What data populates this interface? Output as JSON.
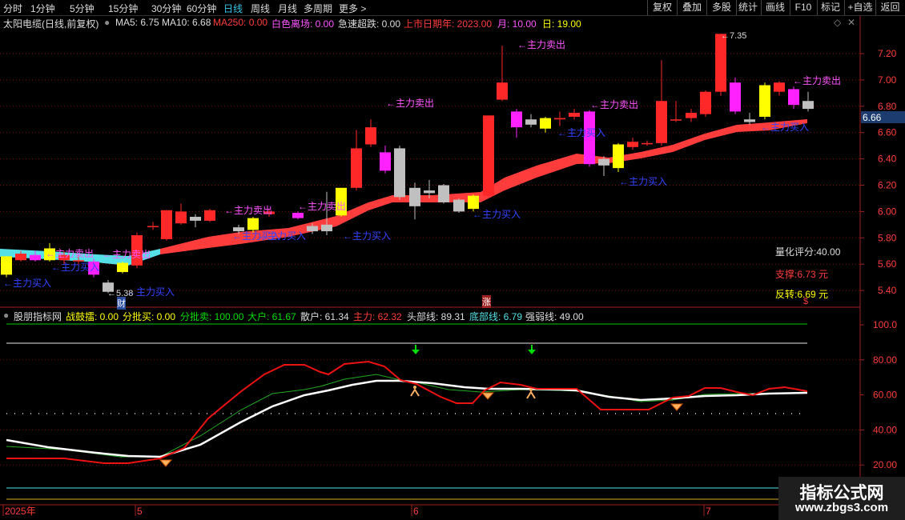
{
  "toolbar": {
    "periods": [
      "分时",
      "1分钟",
      "5分钟",
      "15分钟",
      "30分钟",
      "60分钟",
      "日线",
      "周线",
      "月线",
      "多周期",
      "更多 >"
    ],
    "active_period": "日线",
    "buttons": [
      "复权",
      "叠加",
      "多股",
      "统计",
      "画线",
      "F10",
      "标记",
      "+自选",
      "返回"
    ]
  },
  "header": {
    "stock": "太阳电缆(日线,前复权)",
    "ma5": "MA5: 6.75",
    "ma10": "MA10: 6.68",
    "ma250": "MA250: 0.00",
    "white_exit": "白色离场: 0.00",
    "rapid_drop": "急速超跌: 0.00",
    "ipo_year": "上市日期年: 2023.00",
    "ipo_month": "月: 10.00",
    "ipo_day": "日: 19.00"
  },
  "colors": {
    "up": "#ff2828",
    "down": "#ff22ff",
    "yellow": "#ffff00",
    "gray": "#c0c0c0",
    "cyan": "#54e0e6",
    "band": "#ff3c3c",
    "green": "#00cc00"
  },
  "main_chart": {
    "price_ticks": [
      "7.20",
      "7.00",
      "6.80",
      "6.60",
      "6.40",
      "6.20",
      "6.00",
      "5.80",
      "5.60",
      "5.40"
    ],
    "last_price": "6.66",
    "high_label": "7.35",
    "low_label": "5.38",
    "sell_label": "←主力卖出",
    "buy_label": "←主力买入",
    "score": "量化评分:40.00",
    "support": "支撑:6.73 元",
    "reversal": "反转:6.69 元",
    "marker_cai": "财",
    "marker_zhang": "涨",
    "marker_dollar": "$"
  },
  "indicator": {
    "name": "股朋指标网",
    "drum": "战鼓擂: 0.00",
    "split_buy": "分批买: 0.00",
    "split_sell": "分批卖: 100.00",
    "big": "大户: 61.67",
    "retail": "散户: 61.34",
    "main_force": "主力: 62.32",
    "top_line": "头部线: 89.31",
    "bottom_line": "底部线: 6.79",
    "strong_weak": "强弱线: 49.00",
    "ticks": [
      "100.0",
      "80.00",
      "60.00",
      "40.00",
      "20.00"
    ]
  },
  "time_axis": {
    "labels": [
      "2025年",
      "5",
      "6",
      "7"
    ]
  },
  "watermark": {
    "title": "指标公式网",
    "url": "www.zbgs3.com"
  }
}
